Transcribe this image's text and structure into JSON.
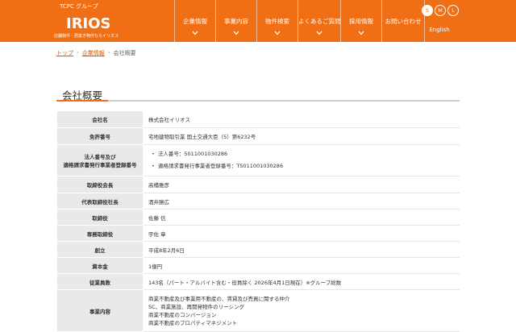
{
  "header": {
    "group_label": "TCPC グループ",
    "logo_text": "IRIOS",
    "tagline": "店舗物件・居抜き物件ならイリオス",
    "colors": {
      "brand": "#f06e14",
      "text_on_brand": "#ffffff"
    }
  },
  "nav": {
    "items": [
      {
        "label": "企業情報"
      },
      {
        "label": "事業内容"
      },
      {
        "label": "物件検索"
      },
      {
        "label": "よくあるご質問"
      },
      {
        "label": "採用情報"
      },
      {
        "label": "お問い合わせ"
      }
    ]
  },
  "font_size": {
    "options": [
      "S",
      "M",
      "L"
    ],
    "selected": "S"
  },
  "language": {
    "label": "English"
  },
  "breadcrumb": [
    {
      "label": "トップ"
    },
    {
      "label": "企業情報"
    },
    {
      "label": "会社概要"
    }
  ],
  "page": {
    "title": "会社概要"
  },
  "company_table": {
    "rows": [
      {
        "label": "会社名",
        "value": "株式会社イリオス"
      },
      {
        "label": "免許番号",
        "value": "宅地建物取引業 国土交通大臣（5）第6232号"
      },
      {
        "label_lines": [
          "法人番号及び",
          "適格請求書発行事業者登録番号"
        ],
        "items": [
          "法人番号：5011001030286",
          "適格請求書発行事業者登録番号：T5011001030286"
        ]
      },
      {
        "label": "取締役会長",
        "value": "高橋雅彦"
      },
      {
        "label": "代表取締役社長",
        "value": "酒井勝広"
      },
      {
        "label": "取締役",
        "value": "佐藤 信"
      },
      {
        "label": "専務取締役",
        "value": "宇佐 章"
      },
      {
        "label": "創立",
        "value": "平成8年2月6日"
      },
      {
        "label": "資本金",
        "value": "1億円"
      },
      {
        "label": "従業員数",
        "value": "143名（パート・アルバイト含む・役員除く 2026年4月1日現在）※グループ総数"
      },
      {
        "label": "事業内容",
        "lines": [
          "商業不動産及び事業用不動産の、賃貸及び売買に関する仲介",
          "SC、商業施設、再開発物件のリーシング",
          "商業不動産のコンバージョン",
          "商業不動産のプロパティマネジメント"
        ]
      }
    ]
  }
}
